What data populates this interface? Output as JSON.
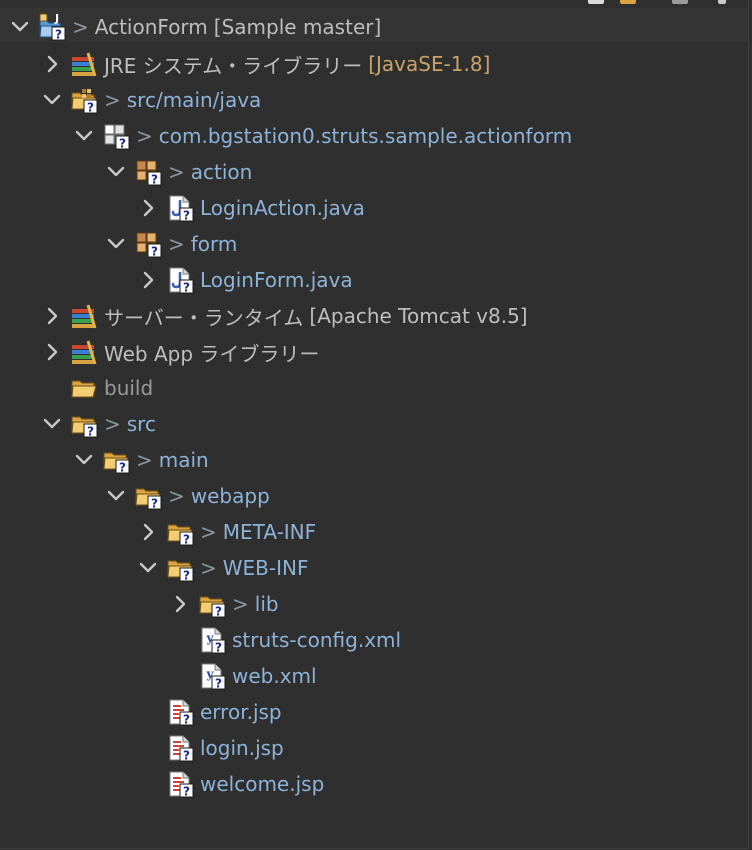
{
  "colors": {
    "background": "#2f2f2f",
    "selection": "#343434",
    "text": "#bebebe",
    "tracked_text": "#8db3d8",
    "ignored_text": "#9a9a9a",
    "decoration": "#c9a467"
  },
  "top_strip": {
    "icons": [
      "toolbar-icon",
      "folder-icon",
      "gear-icon",
      "close-icon"
    ]
  },
  "tree": {
    "project": {
      "dirty_marker": ">",
      "label": "ActionForm",
      "decoration": "[Sample master]"
    },
    "jre_library": {
      "label": "JRE システム・ライブラリー",
      "decoration": "[JavaSE-1.8]"
    },
    "src_main_java": {
      "dirty_marker": ">",
      "label": "src/main/java"
    },
    "package_actionform": {
      "dirty_marker": ">",
      "label": "com.bgstation0.struts.sample.actionform"
    },
    "package_action": {
      "dirty_marker": ">",
      "label": "action"
    },
    "login_action_java": {
      "label": "LoginAction.java"
    },
    "package_form": {
      "dirty_marker": ">",
      "label": "form"
    },
    "login_form_java": {
      "label": "LoginForm.java"
    },
    "server_runtime": {
      "label": "サーバー・ランタイム",
      "decoration": "[Apache Tomcat v8.5]"
    },
    "web_app_libraries": {
      "label": "Web App ライブラリー"
    },
    "build_folder": {
      "label": "build"
    },
    "src_folder": {
      "dirty_marker": ">",
      "label": "src"
    },
    "main_folder": {
      "dirty_marker": ">",
      "label": "main"
    },
    "webapp_folder": {
      "dirty_marker": ">",
      "label": "webapp"
    },
    "meta_inf_folder": {
      "dirty_marker": ">",
      "label": "META-INF"
    },
    "web_inf_folder": {
      "dirty_marker": ">",
      "label": "WEB-INF"
    },
    "lib_folder": {
      "dirty_marker": ">",
      "label": "lib"
    },
    "struts_config_xml": {
      "label": "struts-config.xml"
    },
    "web_xml": {
      "label": "web.xml"
    },
    "error_jsp": {
      "label": "error.jsp"
    },
    "login_jsp": {
      "label": "login.jsp"
    },
    "welcome_jsp": {
      "label": "welcome.jsp"
    }
  }
}
